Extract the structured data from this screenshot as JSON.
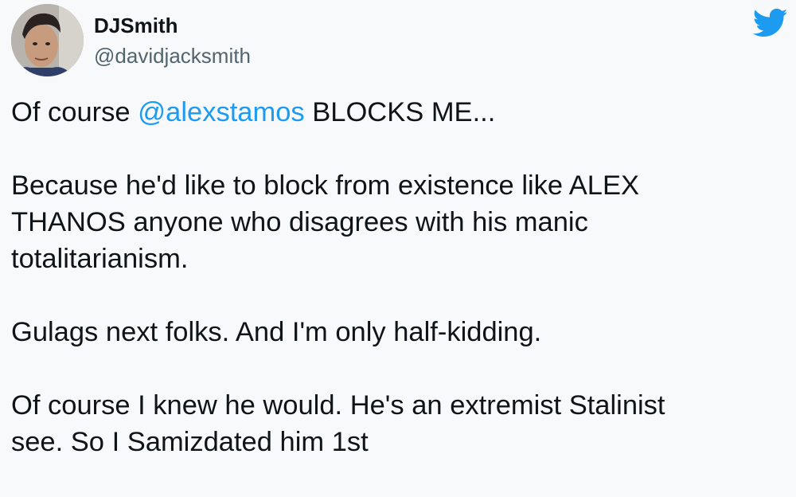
{
  "author": {
    "display_name": "DJSmith",
    "handle": "@davidjacksmith",
    "avatar_icon": "profile-photo"
  },
  "brand": {
    "icon": "twitter-bird-icon",
    "color": "#1d9bf0"
  },
  "tweet": {
    "p1_before": "Of course ",
    "p1_mention": "@alexstamos",
    "p1_after": " BLOCKS ME...",
    "p2_line1": "Because he'd like to block from existence like ALEX",
    "p2_line2": "THANOS anyone who disagrees with his manic",
    "p2_line3": "totalitarianism.",
    "p3": "Gulags next folks. And I'm only half-kidding.",
    "p4_line1": "Of course I knew he would. He's an extremist Stalinist",
    "p4_line2": "see. So I Samizdated him 1st"
  },
  "colors": {
    "text": "#0f1419",
    "secondary": "#536471",
    "mention": "#1d9bf0",
    "background": "#f7f9fa"
  }
}
